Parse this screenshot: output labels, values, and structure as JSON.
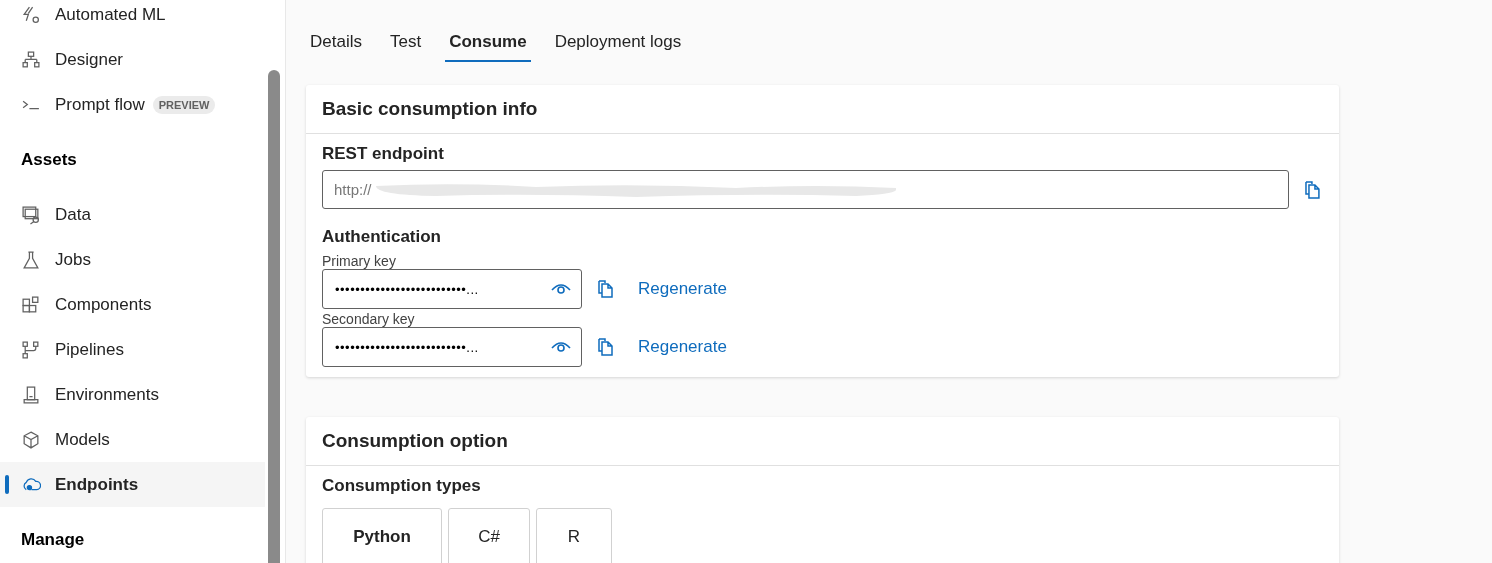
{
  "sidebar": {
    "items": [
      {
        "kind": "item",
        "label": "Automated ML",
        "selected": false
      },
      {
        "kind": "item",
        "label": "Designer",
        "selected": false
      },
      {
        "kind": "item",
        "label": "Prompt flow",
        "badge": "PREVIEW",
        "selected": false
      },
      {
        "kind": "heading",
        "label": "Assets"
      },
      {
        "kind": "item",
        "label": "Data",
        "selected": false
      },
      {
        "kind": "item",
        "label": "Jobs",
        "selected": false
      },
      {
        "kind": "item",
        "label": "Components",
        "selected": false
      },
      {
        "kind": "item",
        "label": "Pipelines",
        "selected": false
      },
      {
        "kind": "item",
        "label": "Environments",
        "selected": false
      },
      {
        "kind": "item",
        "label": "Models",
        "selected": false
      },
      {
        "kind": "item",
        "label": "Endpoints",
        "selected": true
      },
      {
        "kind": "heading",
        "label": "Manage"
      }
    ]
  },
  "tabs": [
    {
      "label": "Details",
      "selected": false
    },
    {
      "label": "Test",
      "selected": false
    },
    {
      "label": "Consume",
      "selected": true
    },
    {
      "label": "Deployment logs",
      "selected": false
    }
  ],
  "basic_info": {
    "title": "Basic consumption info",
    "rest_label": "REST endpoint",
    "rest_value": "http://",
    "auth_label": "Authentication",
    "keys": [
      {
        "label": "Primary key",
        "value": "••••••••••••••••••••••••••...",
        "action": "Regenerate"
      },
      {
        "label": "Secondary key",
        "value": "••••••••••••••••••••••••••...",
        "action": "Regenerate"
      }
    ]
  },
  "consumption": {
    "title": "Consumption option",
    "types_label": "Consumption types",
    "types": [
      {
        "label": "Python",
        "selected": true
      },
      {
        "label": "C#",
        "selected": false
      },
      {
        "label": "R",
        "selected": false
      }
    ]
  }
}
